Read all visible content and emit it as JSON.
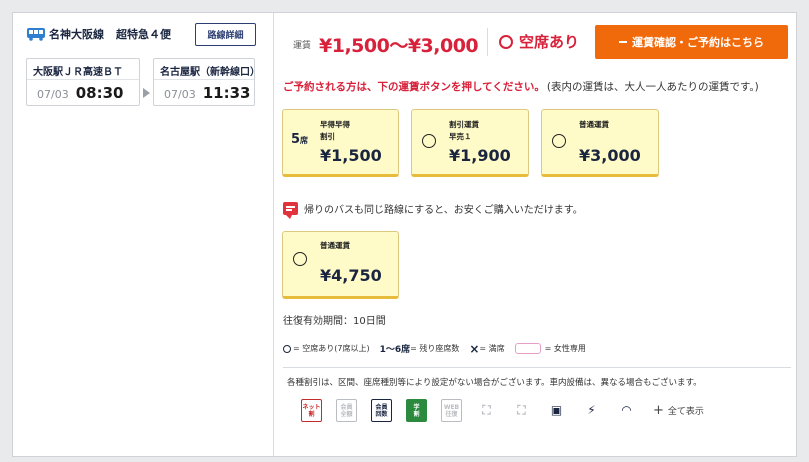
{
  "route": {
    "name": "名神大阪線",
    "bus_no": "超特急４便",
    "detail_button": "路線詳細",
    "from": {
      "stop": "大阪駅ＪＲ高速ＢＴ",
      "date": "07/03",
      "time": "08:30"
    },
    "to": {
      "stop": "名古屋駅（新幹線口）",
      "date": "07/03",
      "time": "11:33"
    }
  },
  "fare": {
    "label": "運賃",
    "range": "¥1,500〜¥3,000",
    "availability": "空席あり",
    "confirm_button": "運賃確認・ご予約はこちら"
  },
  "instruction": {
    "main": "ご予約される方は、下の運賃ボタンを押してください。",
    "note": "(表内の運賃は、大人一人あたりの運賃です。)"
  },
  "fare_options": [
    {
      "seats": "5",
      "seats_unit": "席",
      "type_line1": "早得早得",
      "type_line2": "割引",
      "price": "¥1,500"
    },
    {
      "status": "○",
      "type_line1": "割引運賃",
      "type_line2": "早売１",
      "price": "¥1,900"
    },
    {
      "status": "○",
      "type_line1": "普通運賃",
      "type_line2": "",
      "price": "¥3,000"
    }
  ],
  "promo_text": "帰りのバスも同じ路線にすると、お安くご購入いただけます。",
  "round_trip": {
    "status": "○",
    "type_line1": "普通運賃",
    "price": "¥4,750"
  },
  "validity": "往復有効期間：10日間",
  "legend": {
    "available": "= 空席あり(7席以上)",
    "remaining_bold": "1〜6席",
    "remaining": "= 残り座席数",
    "full": "= 満席",
    "female": "= 女性専用"
  },
  "discount_note": "各種割引は、区間、座席種別等により設定がない場合がございます。車内設備は、異なる場合もございます。",
  "amenities": [
    {
      "icon": "net-discount-icon",
      "line1": "ネット",
      "line2": "割"
    },
    {
      "icon": "member-discount-icon",
      "line1": "会員",
      "line2": "全額"
    },
    {
      "icon": "member-return-icon",
      "line1": "会員",
      "line2": "回数"
    },
    {
      "icon": "student-discount-icon",
      "line1": "学",
      "line2": "割"
    },
    {
      "icon": "web-discount-icon",
      "line1": "WEB",
      "line2": "往復"
    }
  ],
  "show_all": "全て表示",
  "colors": {
    "accent_red": "#d8213a",
    "cta_orange": "#f06a0c",
    "navy": "#1a2540",
    "fare_yellow": "#fffbc9"
  }
}
